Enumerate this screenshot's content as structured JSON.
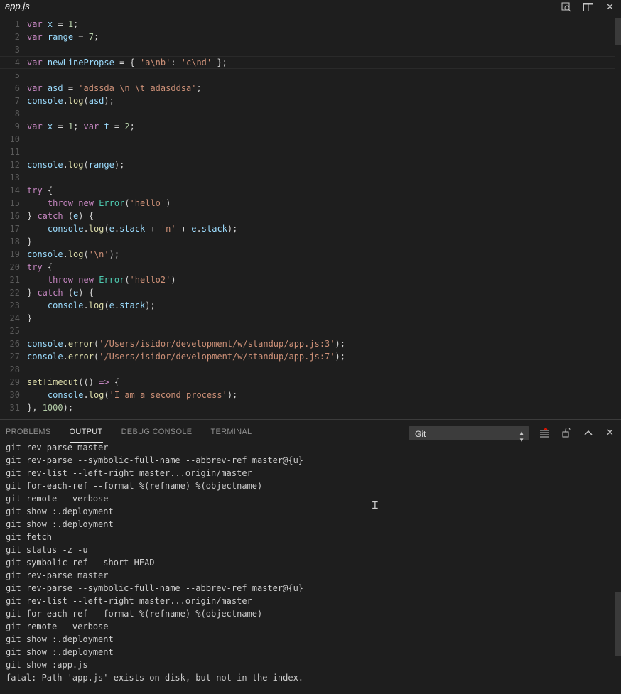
{
  "window": {
    "title": "app.js",
    "actions": [
      {
        "name": "open-preview-icon",
        "glyph": "⌕"
      },
      {
        "name": "split-editor-icon",
        "glyph": "◫"
      },
      {
        "name": "close-editor-icon",
        "glyph": "✕"
      }
    ]
  },
  "editor": {
    "line_numbers": [
      "1",
      "2",
      "3",
      "4",
      "5",
      "6",
      "7",
      "8",
      "9",
      "10",
      "11",
      "12",
      "13",
      "14",
      "15",
      "16",
      "17",
      "18",
      "19",
      "20",
      "21",
      "22",
      "23",
      "24",
      "25",
      "26",
      "27",
      "28",
      "29",
      "30",
      "31"
    ],
    "lines": [
      "var x = 1;",
      "var range = 7;",
      "",
      "var newLinePropse = { 'a\\nb': 'c\\nd' };",
      "",
      "var asd = 'adssda \\n \\t adasddsa';",
      "console.log(asd);",
      "",
      "var x = 1; var t = 2;",
      "",
      "",
      "console.log(range);",
      "",
      "try {",
      "    throw new Error('hello')",
      "} catch (e) {",
      "    console.log(e.stack + 'n' + e.stack);",
      "}",
      "console.log('\\n');",
      "try {",
      "    throw new Error('hello2')",
      "} catch (e) {",
      "    console.log(e.stack);",
      "}",
      "",
      "console.error('/Users/isidor/development/w/standup/app.js:3');",
      "console.error('/Users/isidor/development/w/standup/app.js:7');",
      "",
      "setTimeout(() => {",
      "    console.log('I am a second process');",
      "}, 1000);"
    ]
  },
  "panel": {
    "tabs": [
      "PROBLEMS",
      "OUTPUT",
      "DEBUG CONSOLE",
      "TERMINAL"
    ],
    "active_tab": "OUTPUT",
    "channel_select": "Git",
    "actions": [
      {
        "name": "clear-output-icon",
        "glyph": "≡"
      },
      {
        "name": "lock-scroll-icon",
        "glyph": "🔓"
      },
      {
        "name": "maximize-panel-icon",
        "glyph": "⌃"
      },
      {
        "name": "close-panel-icon",
        "glyph": "✕"
      }
    ],
    "output_lines": [
      "git rev-parse master",
      "git rev-parse --symbolic-full-name --abbrev-ref master@{u}",
      "git rev-list --left-right master...origin/master",
      "git for-each-ref --format %(refname) %(objectname)",
      "git remote --verbose",
      "git show :.deployment",
      "git show :.deployment",
      "git fetch",
      "git status -z -u",
      "git symbolic-ref --short HEAD",
      "git rev-parse master",
      "git rev-parse --symbolic-full-name --abbrev-ref master@{u}",
      "git rev-list --left-right master...origin/master",
      "git for-each-ref --format %(refname) %(objectname)",
      "git remote --verbose",
      "git show :.deployment",
      "git show :.deployment",
      "git show :app.js",
      "fatal: Path 'app.js' exists on disk, but not in the index."
    ]
  },
  "colors": {
    "background": "#1e1e1e",
    "keyword": "#c586c0",
    "string": "#ce9178",
    "number": "#b5cea8",
    "function": "#dcdcaa",
    "variable": "#9cdcfe"
  }
}
